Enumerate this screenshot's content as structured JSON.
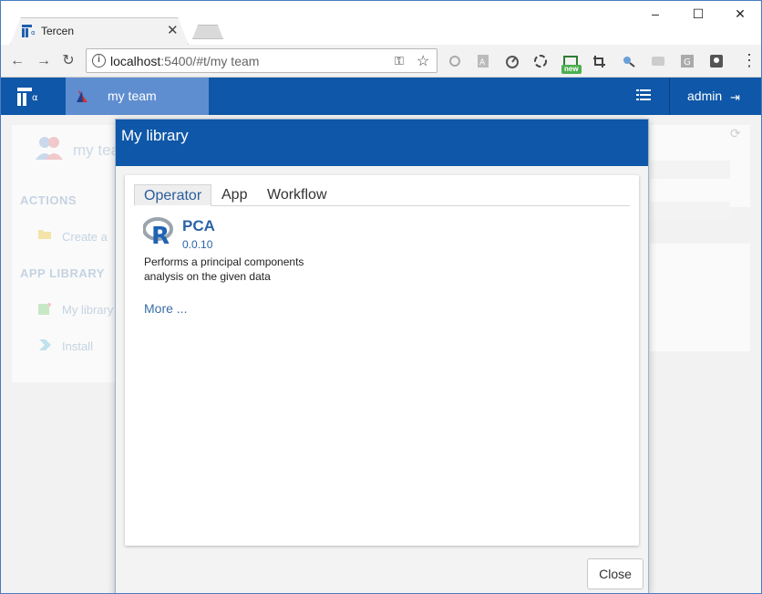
{
  "browser": {
    "tab_title": "Tercen",
    "tab_close": "✕",
    "url_host": "localhost",
    "url_rest": ":5400/#t/my team",
    "ext_new_badge": "new",
    "window_controls": {
      "minimize": "–",
      "maximize": "☐",
      "close": "✕"
    },
    "nav": {
      "back": "←",
      "forward": "→",
      "reload": "↻"
    },
    "icons": [
      "key-icon",
      "star-icon",
      "extension-icons",
      "menu-icon"
    ]
  },
  "app": {
    "team_label": "my team",
    "user_label": "admin",
    "accent": "#0f57a8",
    "team_tab_color": "#5f8ed0"
  },
  "background": {
    "team_name": "my tea",
    "actions_heading": "ACTIONS",
    "actions_item": "Create a",
    "library_heading": "APP LIBRARY",
    "library_items": [
      "My library",
      "Install"
    ]
  },
  "modal": {
    "title": "My library",
    "tabs": [
      "Operator",
      "App",
      "Workflow"
    ],
    "active_tab": "Operator",
    "operator": {
      "name": "PCA",
      "version": "0.0.10",
      "description": "Performs a principal components analysis on the given data",
      "logo": "r-logo-icon"
    },
    "more_link": "More ...",
    "close_label": "Close"
  }
}
